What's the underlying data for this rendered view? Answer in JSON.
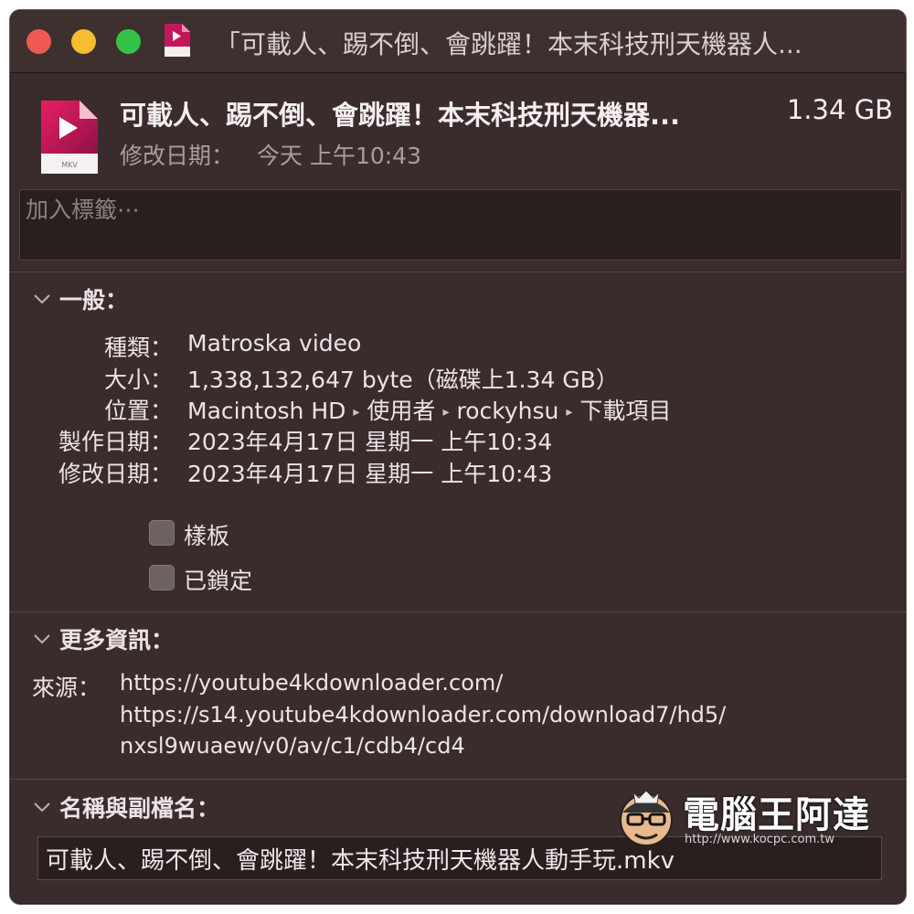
{
  "window": {
    "title": "「可載人、踢不倒、會跳躍！本末科技刑天機器人..."
  },
  "header": {
    "file_name": "可載人、踢不倒、會跳躍！本末科技刑天機器...",
    "file_size": "1.34 GB",
    "modified_label": "修改日期：",
    "modified_value": "今天 上午10:43",
    "file_icon": "mkv-video-file-icon",
    "icon_badge": "MKV"
  },
  "tags": {
    "placeholder": "加入標籤⋯"
  },
  "general": {
    "heading": "一般：",
    "rows": [
      {
        "label": "種類：",
        "value": "Matroska video"
      },
      {
        "label": "大小：",
        "value": "1,338,132,647 byte（磁碟上1.34 GB）"
      },
      {
        "label": "位置：",
        "value_parts": [
          "Macintosh HD",
          "使用者",
          "rockyhsu",
          "下載項目"
        ]
      },
      {
        "label": "製作日期：",
        "value": "2023年4月17日 星期一 上午10:34"
      },
      {
        "label": "修改日期：",
        "value": "2023年4月17日 星期一 上午10:43"
      }
    ],
    "stationery_label": "樣板",
    "locked_label": "已鎖定",
    "stationery_checked": false,
    "locked_checked": false
  },
  "more_info": {
    "heading": "更多資訊：",
    "source_label": "來源：",
    "source_lines": [
      "https://youtube4kdownloader.com/",
      "https://s14.youtube4kdownloader.com/download7/hd5/",
      "nxsl9wuaew/v0/av/c1/cdb4/cd4"
    ]
  },
  "name_ext": {
    "heading": "名稱與副檔名：",
    "value": "可載人、踢不倒、會跳躍！本末科技刑天機器人動手玩.mkv"
  },
  "watermark": {
    "text": "電腦王阿達",
    "url": "http://www.kocpc.com.tw"
  },
  "colors": {
    "background": "#3a2c2c",
    "close": "#ee5a52",
    "minimize": "#f5bd2f",
    "maximize": "#35c248",
    "icon_accent": "#d81b60"
  }
}
